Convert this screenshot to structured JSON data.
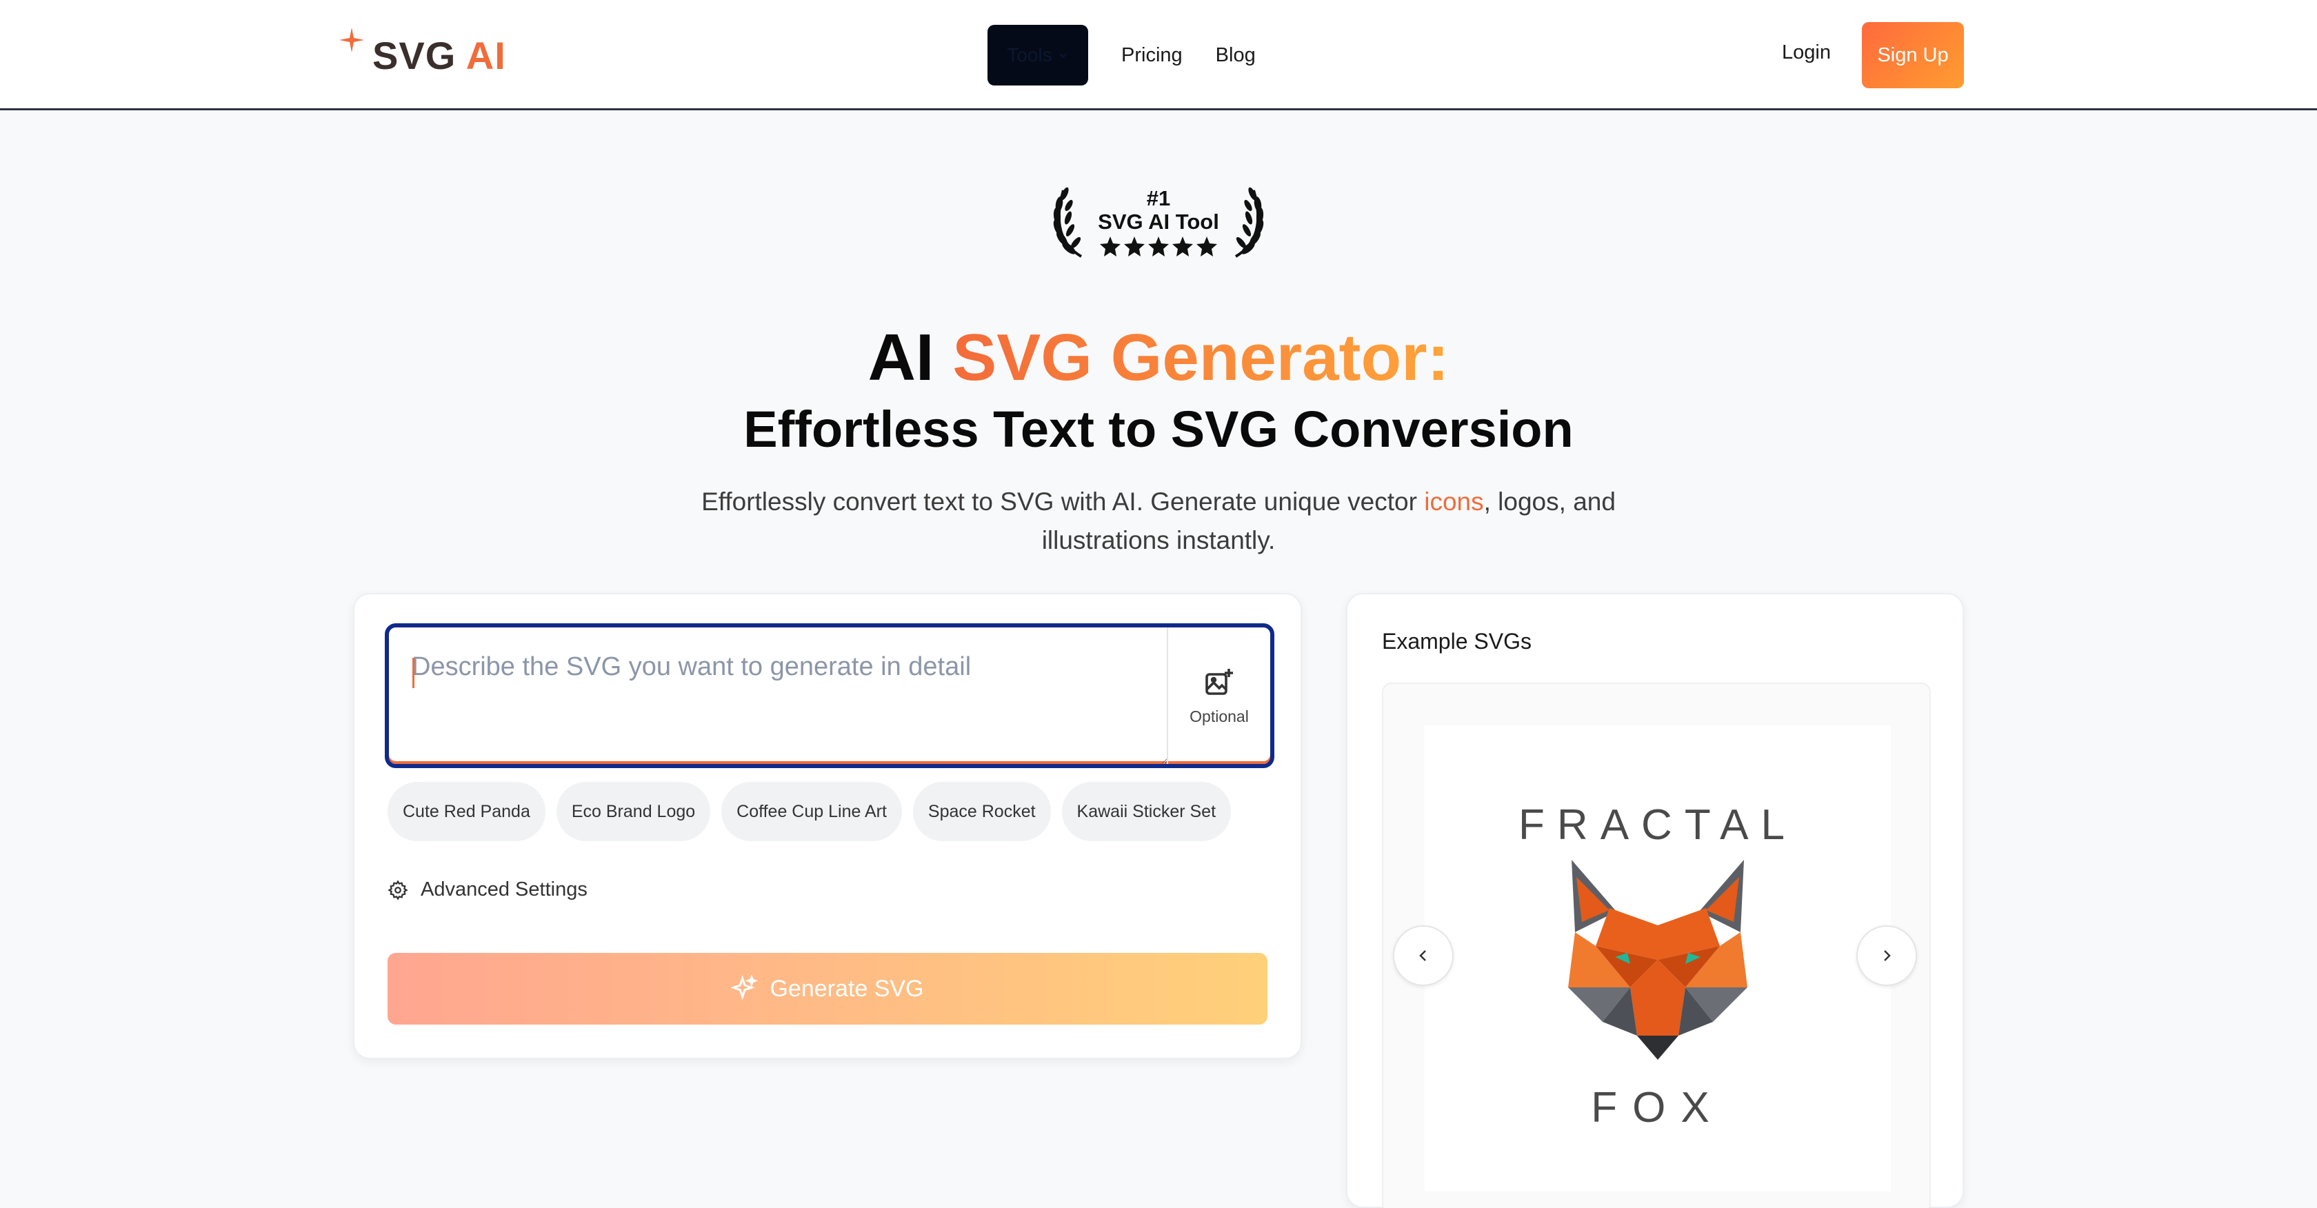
{
  "brand": {
    "part1": "SVG",
    "part2": "AI"
  },
  "nav": {
    "tools": "Tools",
    "pricing": "Pricing",
    "blog": "Blog",
    "login": "Login",
    "signup": "Sign Up"
  },
  "badge": {
    "rank": "#1",
    "title": "SVG AI Tool"
  },
  "hero": {
    "title_part1": "AI ",
    "title_accent": "SVG Generator:",
    "subtitle": "Effortless Text to SVG Conversion",
    "lead_part1": "Effortlessly convert text to SVG with AI. Generate unique vector ",
    "lead_link": "icons",
    "lead_part2": ", logos, and illustrations instantly."
  },
  "prompt": {
    "placeholder": "Describe the SVG you want to generate in detail",
    "value": "",
    "upload_label": "Optional"
  },
  "chips": [
    "Cute Red Panda",
    "Eco Brand Logo",
    "Coffee Cup Line Art",
    "Space Rocket",
    "Kawaii Sticker Set"
  ],
  "advanced_settings": "Advanced Settings",
  "generate_label": "Generate SVG",
  "examples": {
    "title": "Example SVGs",
    "image_word1": "FRACTAL",
    "image_word2": "FOX"
  },
  "colors": {
    "accent": "#f06c3b",
    "accent_light": "#ffa43a",
    "focus": "#0f2a8a",
    "dark": "#050a18"
  }
}
